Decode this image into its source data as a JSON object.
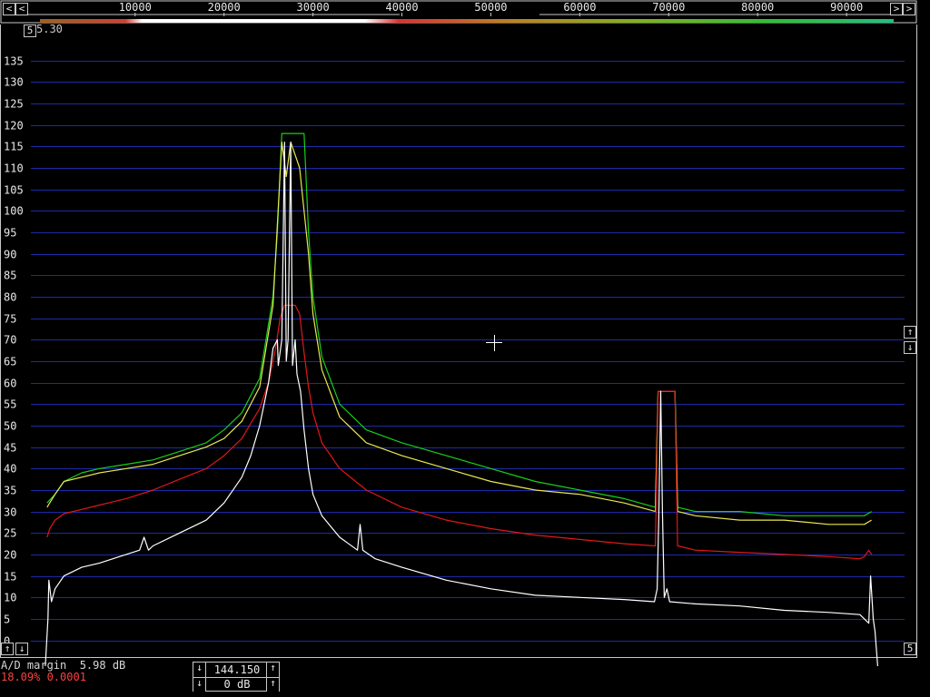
{
  "colors": {
    "grid": "#1c2aa8",
    "axis_frame": "#c8c8c8",
    "trace_peak": "#18d018",
    "trace_average": "#e8e850",
    "trace_baseline": "#e01818",
    "trace_instant": "#ffffff",
    "status_red": "#ff4040"
  },
  "toolbar": {
    "scroll_left_icon": "arrow-left-icon",
    "scroll_right_icon": "arrow-right-icon",
    "zoom_label": "5.30"
  },
  "side_buttons": {
    "top_left_label": "5",
    "bottom_right_label": "5",
    "up_glyph": "↑",
    "down_glyph": "↓",
    "left_glyph": "<",
    "right_glyph": ">"
  },
  "status": {
    "ad_margin": "A/D margin  5.98 dB",
    "cpu_line": "18.09% 0.0001"
  },
  "freq_control": {
    "frequency": "144.150",
    "gain": "0 dB"
  },
  "chart_data": {
    "type": "line",
    "xlabel": "",
    "ylabel": "",
    "x_ticks": [
      "10000",
      "20000",
      "30000",
      "40000",
      "50000",
      "60000",
      "70000",
      "80000",
      "90000"
    ],
    "x_tick_values": [
      10000,
      20000,
      30000,
      40000,
      50000,
      60000,
      70000,
      80000,
      90000
    ],
    "xlim": [
      -700,
      95500
    ],
    "y_ticks": [
      0,
      5,
      10,
      15,
      20,
      25,
      30,
      35,
      40,
      45,
      50,
      55,
      60,
      65,
      70,
      75,
      80,
      85,
      90,
      95,
      100,
      105,
      110,
      115,
      120,
      125,
      130,
      135
    ],
    "ylim": [
      -6,
      140
    ],
    "grid": true,
    "series": [
      {
        "role": "peak",
        "x": [
          100,
          1000,
          2000,
          4000,
          6000,
          9000,
          12000,
          15000,
          18000,
          20000,
          22000,
          24000,
          25500,
          26000,
          26500,
          27000,
          27500,
          28000,
          28500,
          29000,
          29500,
          30000,
          31000,
          33000,
          36000,
          40000,
          45000,
          50000,
          55000,
          60000,
          65000,
          68500,
          68800,
          69200,
          70700,
          71000,
          73000,
          78000,
          83000,
          88000,
          92000,
          92800
        ],
        "y": [
          32,
          34,
          37,
          39,
          40,
          41,
          42,
          44,
          46,
          49,
          53,
          61,
          80,
          95,
          118,
          118,
          118,
          118,
          118,
          118,
          95,
          80,
          66,
          55,
          49,
          46,
          43,
          40,
          37,
          35,
          33,
          31,
          58,
          58,
          58,
          31,
          30,
          30,
          29,
          29,
          29,
          30
        ]
      },
      {
        "role": "average",
        "x": [
          100,
          1000,
          2000,
          4000,
          6000,
          9000,
          12000,
          15000,
          18000,
          20000,
          22000,
          24000,
          25500,
          26500,
          27000,
          27500,
          28500,
          29500,
          30000,
          31000,
          33000,
          36000,
          40000,
          45000,
          50000,
          55000,
          60000,
          65000,
          68500,
          68800,
          69200,
          70700,
          71000,
          73000,
          78000,
          83000,
          88000,
          92000,
          92800
        ],
        "y": [
          31,
          34,
          37,
          38,
          39,
          40,
          41,
          43,
          45,
          47,
          51,
          59,
          78,
          116,
          108,
          116,
          110,
          90,
          76,
          63,
          52,
          46,
          43,
          40,
          37,
          35,
          34,
          32,
          30,
          58,
          58,
          58,
          30,
          29,
          28,
          28,
          27,
          27,
          28
        ]
      },
      {
        "role": "baseline",
        "x": [
          100,
          400,
          1000,
          2000,
          4000,
          6000,
          9000,
          12000,
          15000,
          18000,
          20000,
          22000,
          24000,
          25000,
          25800,
          26300,
          26800,
          27000,
          27500,
          28000,
          28500,
          29000,
          29500,
          30000,
          31000,
          33000,
          36000,
          40000,
          45000,
          50000,
          55000,
          60000,
          65000,
          68500,
          68800,
          69200,
          70700,
          71000,
          73000,
          78000,
          83000,
          88000,
          91500,
          92000,
          92500,
          92800
        ],
        "y": [
          24,
          26,
          28,
          29.5,
          30.5,
          31.5,
          33,
          35,
          37.5,
          40,
          43,
          47,
          54,
          60,
          68,
          75,
          78,
          78,
          78,
          78,
          76,
          67,
          59,
          53,
          46,
          40,
          35,
          31,
          28,
          26,
          24.5,
          23.5,
          22.5,
          22,
          58,
          58,
          58,
          22,
          21,
          20.5,
          20,
          19.5,
          19,
          19.5,
          21,
          20
        ]
      },
      {
        "role": "instant",
        "x": [
          -100,
          200,
          300,
          600,
          1000,
          2000,
          4000,
          6000,
          9000,
          10500,
          11000,
          11500,
          12000,
          15000,
          18000,
          20000,
          22000,
          23000,
          24000,
          25000,
          25500,
          26000,
          26100,
          26500,
          26800,
          27000,
          27200,
          27500,
          27700,
          28000,
          28200,
          28600,
          29000,
          29500,
          30000,
          31000,
          33000,
          35000,
          35300,
          35600,
          37000,
          40000,
          45000,
          50000,
          55000,
          60000,
          65000,
          68400,
          68700,
          68900,
          69100,
          69300,
          69500,
          69800,
          70100,
          73000,
          78000,
          83000,
          88000,
          91500,
          92500,
          92700,
          93000,
          93200,
          93500
        ],
        "y": [
          -6,
          5,
          14,
          9,
          12,
          15,
          17,
          18,
          20,
          21,
          24,
          21,
          22,
          25,
          28,
          32,
          38,
          43,
          50,
          60,
          68,
          70,
          64,
          70,
          116,
          65,
          70,
          116,
          64,
          70,
          62,
          58,
          49,
          40,
          34,
          29,
          24,
          21,
          27,
          21,
          19,
          17,
          14,
          12,
          10.5,
          10,
          9.5,
          9,
          12,
          30,
          58,
          30,
          10,
          12,
          9,
          8.5,
          8,
          7,
          6.5,
          6,
          4,
          15,
          5,
          2,
          -6
        ]
      }
    ]
  }
}
